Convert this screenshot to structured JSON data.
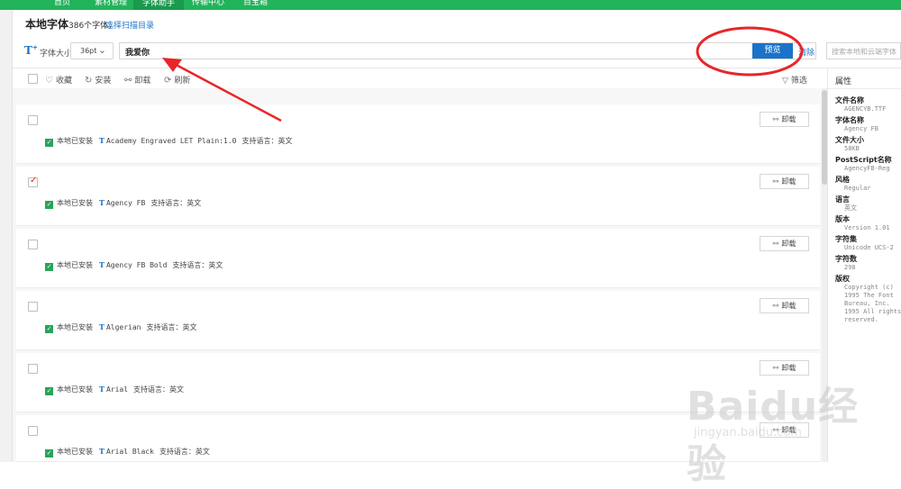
{
  "nav": {
    "items": [
      {
        "label": "首页",
        "active": false
      },
      {
        "label": "素材管理",
        "active": false
      },
      {
        "label": "字体助手",
        "active": true
      },
      {
        "label": "传输中心",
        "active": false
      },
      {
        "label": "百宝箱",
        "active": false
      }
    ]
  },
  "header": {
    "title": "本地字体",
    "count": "386个字体，",
    "scan_link": "选择扫描目录"
  },
  "toolbar": {
    "size_label": "字体大小",
    "size_value": "36pt",
    "preview_text": "我爱你",
    "preview_button": "预览",
    "clear_link": "清除",
    "search_placeholder": "搜索本地和云端字体"
  },
  "actions": {
    "favorite": "收藏",
    "install": "安装",
    "uninstall": "卸载",
    "refresh": "刷新",
    "filter": "筛选"
  },
  "fonts": [
    {
      "name": "Academy Engraved LET Plain:1.0",
      "lang": "支持语言：英文",
      "status": "本地已安装",
      "checked": false,
      "button": "卸载"
    },
    {
      "name": "Agency FB",
      "lang": "支持语言：英文",
      "status": "本地已安装",
      "checked": true,
      "button": "卸载"
    },
    {
      "name": "Agency FB Bold",
      "lang": "支持语言：英文",
      "status": "本地已安装",
      "checked": false,
      "button": "卸载"
    },
    {
      "name": "Algerian",
      "lang": "支持语言：英文",
      "status": "本地已安装",
      "checked": false,
      "button": "卸载"
    },
    {
      "name": "Arial",
      "lang": "支持语言：英文",
      "status": "本地已安装",
      "checked": false,
      "button": "卸载"
    },
    {
      "name": "Arial Black",
      "lang": "支持语言：英文",
      "status": "本地已安装",
      "checked": false,
      "button": "卸载"
    }
  ],
  "properties": {
    "title": "属性",
    "items": [
      {
        "key": "文件名称",
        "value": "AGENCYB.TTF"
      },
      {
        "key": "字体名称",
        "value": "Agency FB"
      },
      {
        "key": "文件大小",
        "value": "58KB"
      },
      {
        "key": "PostScript名称",
        "value": "AgencyFB-Reg"
      },
      {
        "key": "风格",
        "value": "Regular"
      },
      {
        "key": "语言",
        "value": "英文"
      },
      {
        "key": "版本",
        "value": "Version 1.01"
      },
      {
        "key": "字符集",
        "value": "Unicode UCS-2"
      },
      {
        "key": "字符数",
        "value": "298"
      },
      {
        "key": "版权",
        "value": "Copyright (c) 1995 The Font Bureau, Inc. 1995 All rights reserved."
      }
    ]
  },
  "watermark": {
    "logo": "Baidu经验",
    "url": "jingyan.baidu.com"
  },
  "colors": {
    "brand_green": "#22b35b",
    "accent_blue": "#1a73c9",
    "annotation_red": "#e8262a"
  }
}
